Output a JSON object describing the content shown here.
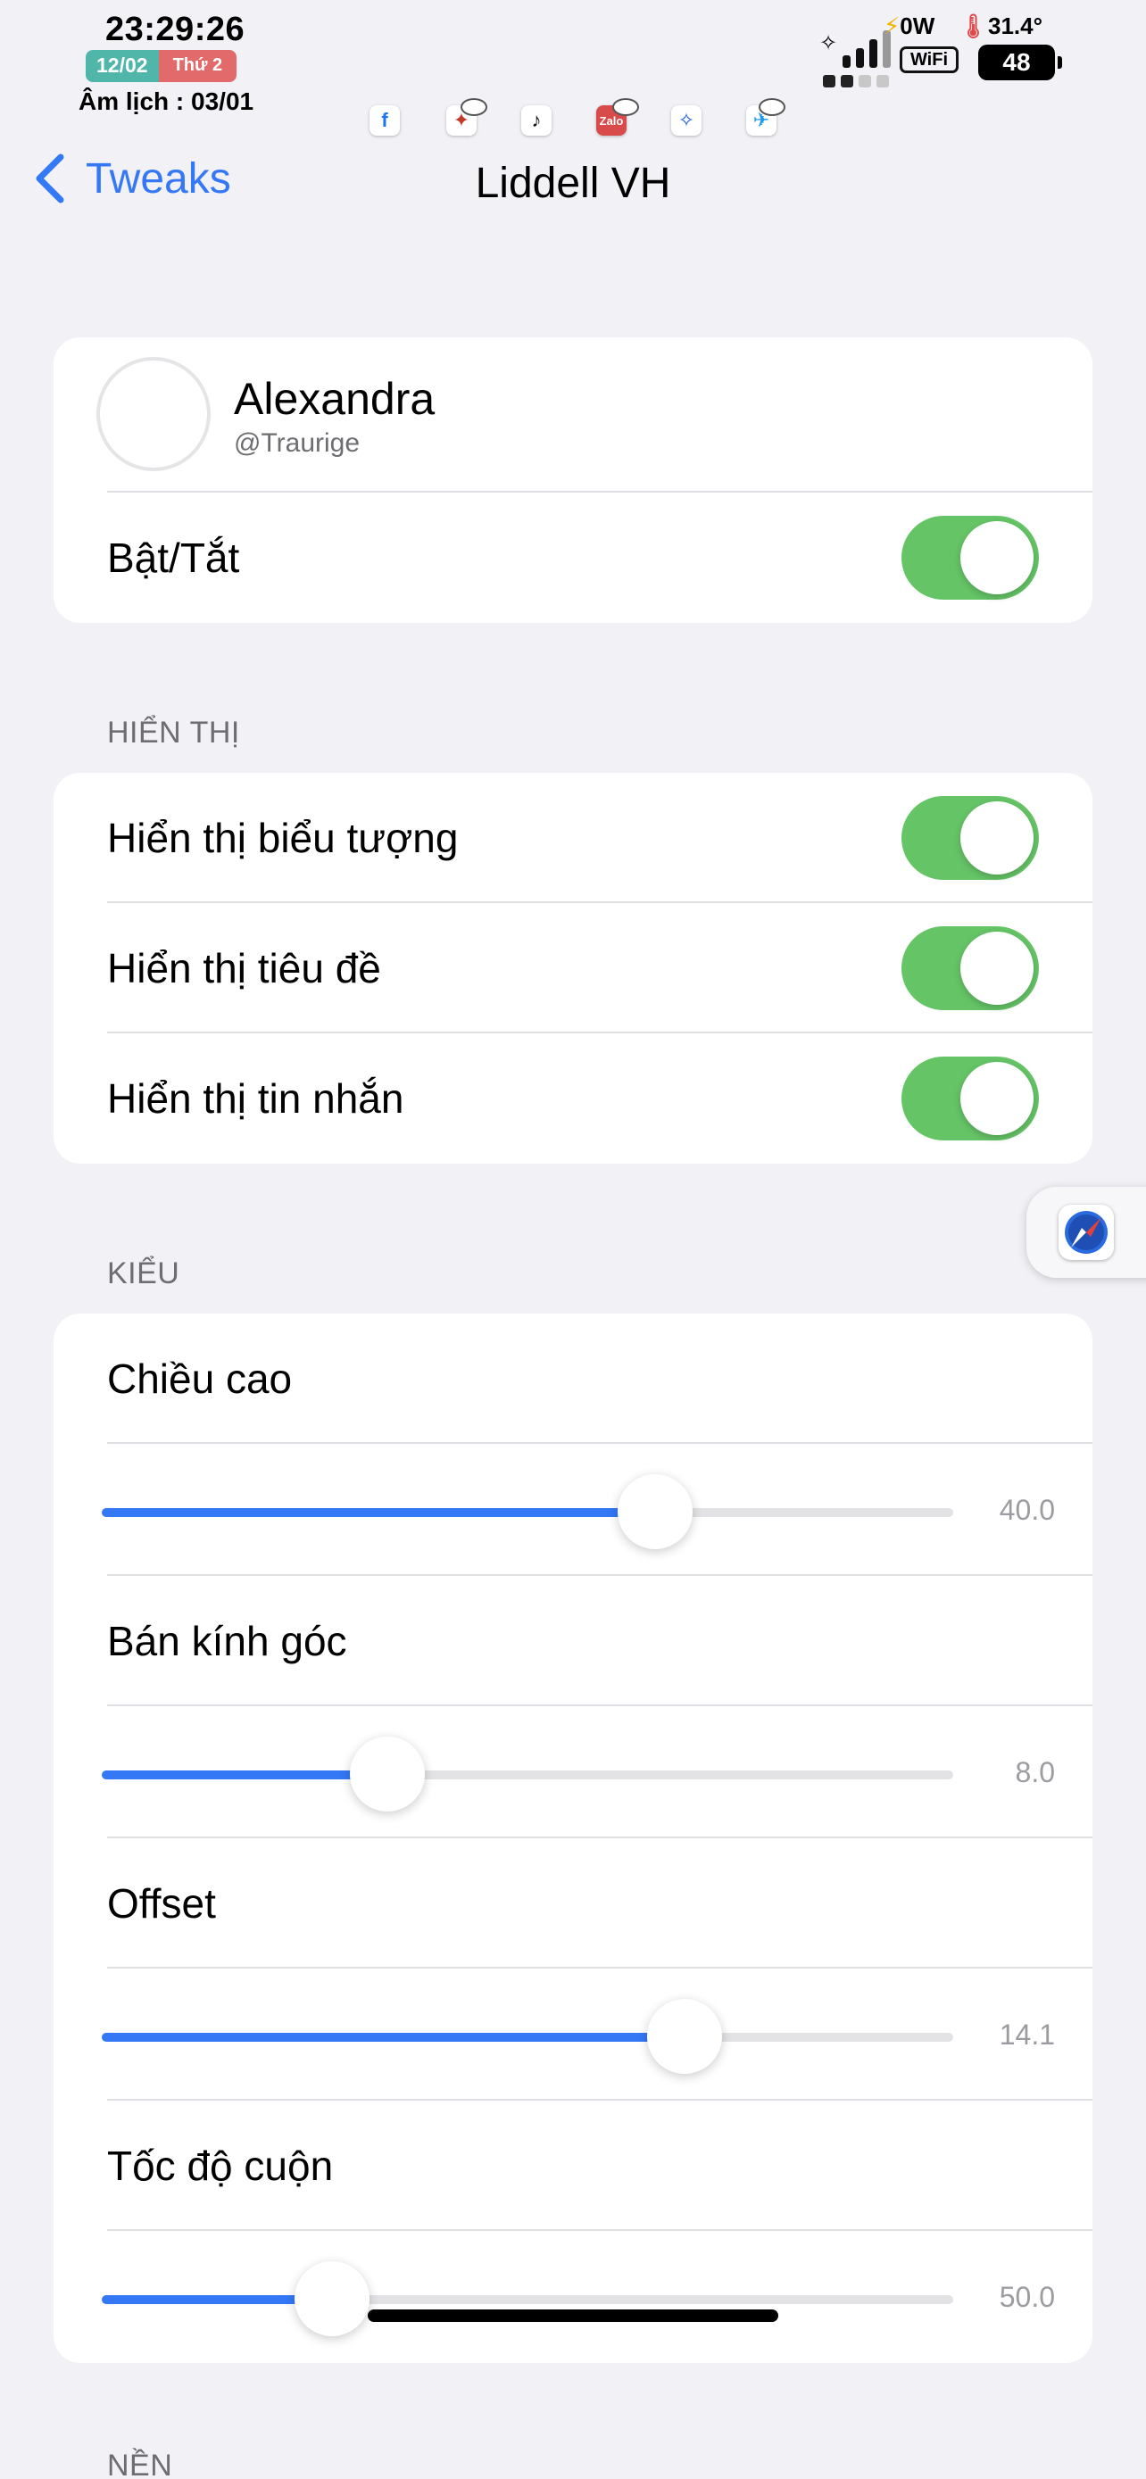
{
  "status": {
    "time": "23:29:26",
    "date": "12/02",
    "weekday": "Thứ 2",
    "lunar": "Âm lịch : 03/01",
    "power": "0W",
    "temperature": "31.4°",
    "wifi": "WiFi",
    "battery": "48",
    "mini_apps": [
      "facebook-icon",
      "messenger-icon",
      "tiktok-icon",
      "zalo-icon",
      "safari-icon",
      "twitter-icon"
    ],
    "zalo_label": "Zalo"
  },
  "nav": {
    "back_label": "Tweaks",
    "title": "Liddell VH"
  },
  "profile": {
    "name": "Alexandra",
    "handle": "@Traurige",
    "toggle_label": "Bật/Tắt",
    "toggle_on": true
  },
  "display": {
    "header": "HIỂN THỊ",
    "items": [
      {
        "label": "Hiển thị biểu tượng",
        "on": true
      },
      {
        "label": "Hiển thị tiêu đề",
        "on": true
      },
      {
        "label": "Hiển thị tin nhắn",
        "on": true
      }
    ]
  },
  "style": {
    "header": "KIỂU",
    "sliders": [
      {
        "label": "Chiều cao",
        "value": "40.0",
        "fraction": 0.65
      },
      {
        "label": "Bán kính góc",
        "value": "8.0",
        "fraction": 0.335
      },
      {
        "label": "Offset",
        "value": "14.1",
        "fraction": 0.685
      },
      {
        "label": "Tốc độ cuộn",
        "value": "50.0",
        "fraction": 0.27
      }
    ]
  },
  "background": {
    "header": "NỀN"
  }
}
